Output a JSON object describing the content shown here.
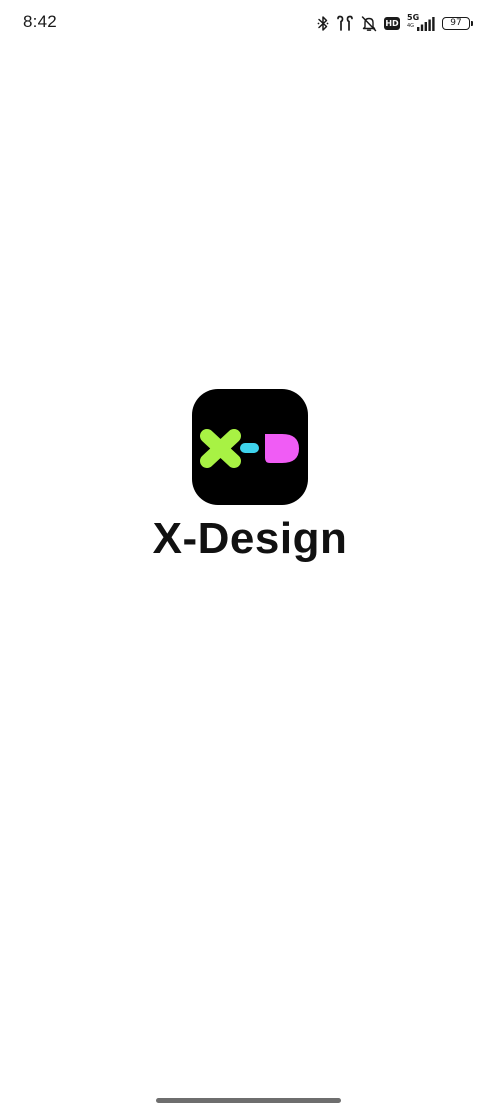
{
  "status_bar": {
    "time": "8:42",
    "network_label": "5G",
    "network_sub": "4G",
    "hd_badge": "HD",
    "battery_level": "97",
    "icons": [
      "bluetooth-icon",
      "earbuds-icon",
      "bell-muted-icon",
      "hd-icon",
      "signal-icon",
      "battery-icon"
    ]
  },
  "splash": {
    "app_name": "X-Design",
    "logo": {
      "background_color": "#000000",
      "x_color": "#A8F244",
      "dash_color": "#3ED3EC",
      "d_color": "#F05CF5"
    }
  },
  "colors": {
    "background": "#FFFFFF",
    "text": "#111111",
    "home_indicator": "#6E6E6E"
  }
}
